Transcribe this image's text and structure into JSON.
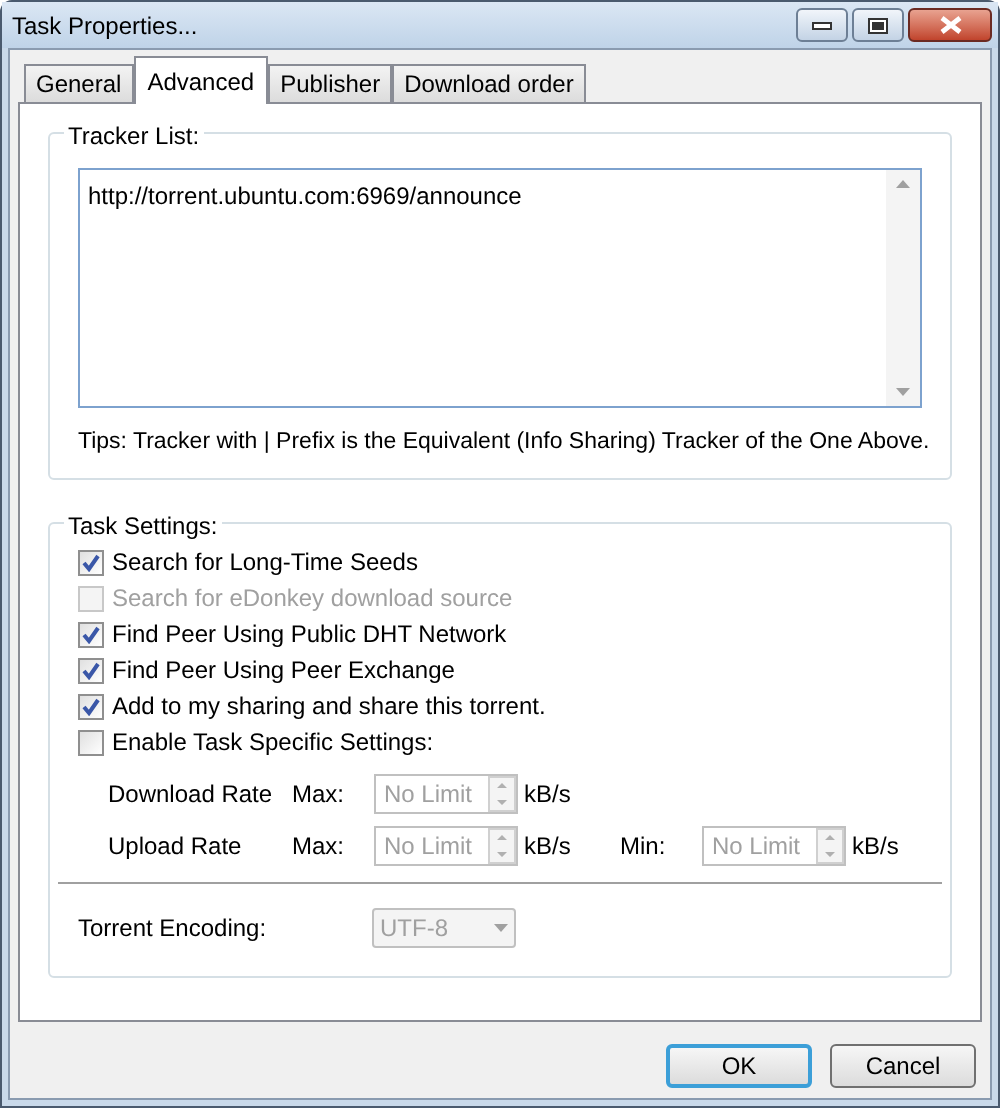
{
  "window": {
    "title": "Task Properties..."
  },
  "tabs": [
    {
      "label": "General",
      "selected": false
    },
    {
      "label": "Advanced",
      "selected": true
    },
    {
      "label": "Publisher",
      "selected": false
    },
    {
      "label": "Download order",
      "selected": false
    }
  ],
  "tracker_list": {
    "label": "Tracker List:",
    "value": "http://torrent.ubuntu.com:6969/announce",
    "tip": "Tips: Tracker with | Prefix is the Equivalent (Info Sharing) Tracker of the One Above."
  },
  "task_settings": {
    "label": "Task Settings:",
    "options": [
      {
        "label": "Search for Long-Time Seeds",
        "checked": true,
        "disabled": false
      },
      {
        "label": "Search for eDonkey download source",
        "checked": false,
        "disabled": true
      },
      {
        "label": "Find Peer Using Public DHT Network",
        "checked": true,
        "disabled": false
      },
      {
        "label": "Find Peer Using Peer Exchange",
        "checked": true,
        "disabled": false
      },
      {
        "label": "Add to my sharing and share this torrent.",
        "checked": true,
        "disabled": false
      },
      {
        "label": "Enable Task Specific Settings:",
        "checked": false,
        "disabled": false
      }
    ],
    "rates": [
      {
        "label": "Download Rate",
        "fields": [
          {
            "label": "Max:",
            "value": "No Limit",
            "unit": "kB/s",
            "disabled": true
          }
        ]
      },
      {
        "label": "Upload Rate",
        "fields": [
          {
            "label": "Max:",
            "value": "No Limit",
            "unit": "kB/s",
            "disabled": true
          },
          {
            "label": "Min:",
            "value": "No Limit",
            "unit": "kB/s",
            "disabled": true
          }
        ]
      }
    ],
    "encoding": {
      "label": "Torrent Encoding:",
      "value": "UTF-8",
      "disabled": true
    }
  },
  "buttons": [
    {
      "label": "OK",
      "default": true
    },
    {
      "label": "Cancel",
      "default": false
    }
  ]
}
